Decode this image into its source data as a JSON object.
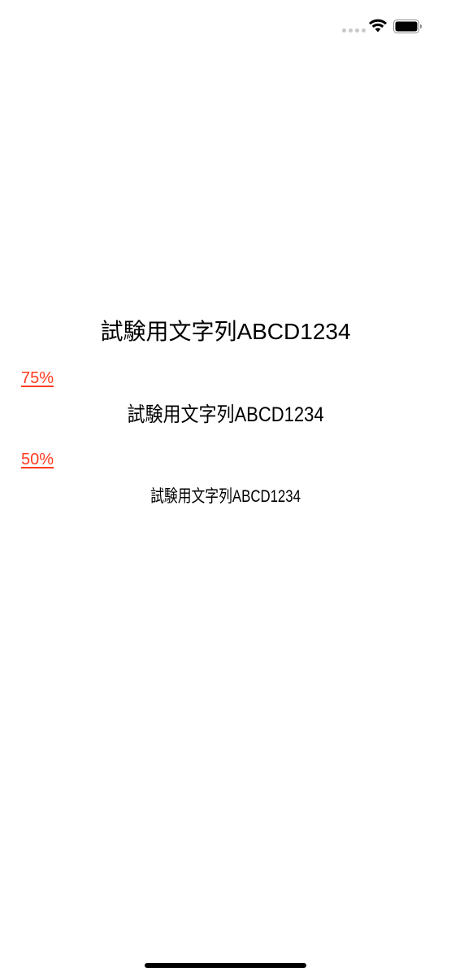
{
  "status_bar": {
    "signal_icon": "signal-dots-icon",
    "wifi_icon": "wifi-icon",
    "battery_icon": "battery-icon"
  },
  "samples": [
    {
      "text": "試験用文字列ABCD1234"
    },
    {
      "label": "75%",
      "text": "試験用文字列ABCD1234"
    },
    {
      "label": "50%",
      "text": "試験用文字列ABCD1234"
    }
  ],
  "colors": {
    "link": "#ff3b1f",
    "text": "#000000",
    "background": "#ffffff"
  }
}
